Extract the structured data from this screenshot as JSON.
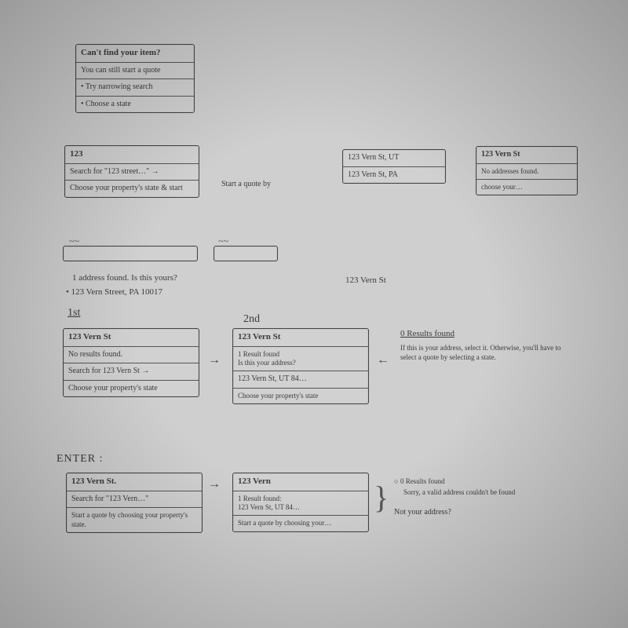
{
  "cantfind": {
    "title": "Can't find your item?",
    "sub": "You can still start a quote",
    "opt1": "• Try narrowing search",
    "opt2": "• Choose a state"
  },
  "topInput": {
    "value": "123",
    "search": "Search for \"123 street…\" →",
    "choose": "Choose your property's state & start"
  },
  "topNote": "Start a quote by",
  "listA": {
    "r1": "123 Vern St, UT",
    "r2": "123 Vern St, PA"
  },
  "listB": {
    "hdr": "123 Vern St",
    "msg": "No addresses found.",
    "opt": "choose your…"
  },
  "found": {
    "line1": "1 address found. Is this yours?",
    "line2": "• 123 Vern Street, PA 10017"
  },
  "foundAside": "123 Vern St",
  "lbl1st": "1st",
  "lbl2nd": "2nd",
  "card1": {
    "hdr": "123 Vern St",
    "r1": "No results found.",
    "r2": "Search for 123 Vern St →",
    "r3": "Choose your property's state"
  },
  "card2": {
    "hdr": "123 Vern St",
    "r1a": "1 Result found",
    "r1b": "Is this your address?",
    "r2": "123 Vern St, UT 84…",
    "r3": "Choose your property's state"
  },
  "side": {
    "hdr": "0 Results found",
    "body": "If this is your address, select it. Otherwise, you'll have to select a quote by selecting a state."
  },
  "enter": "ENTER :",
  "card3": {
    "hdr": "123 Vern St.",
    "r1": "Search for \"123 Vern…\"",
    "r2": "Start a quote by choosing your property's state."
  },
  "card4": {
    "hdr": "123 Vern",
    "r1a": "1 Result found:",
    "r1b": "123 Vern St, UT 84…",
    "r2": "Start a quote by choosing your…"
  },
  "bottomSide": {
    "l1": "0 Results found",
    "l2": "Sorry, a valid address couldn't be found",
    "l3": "Not your address?"
  }
}
